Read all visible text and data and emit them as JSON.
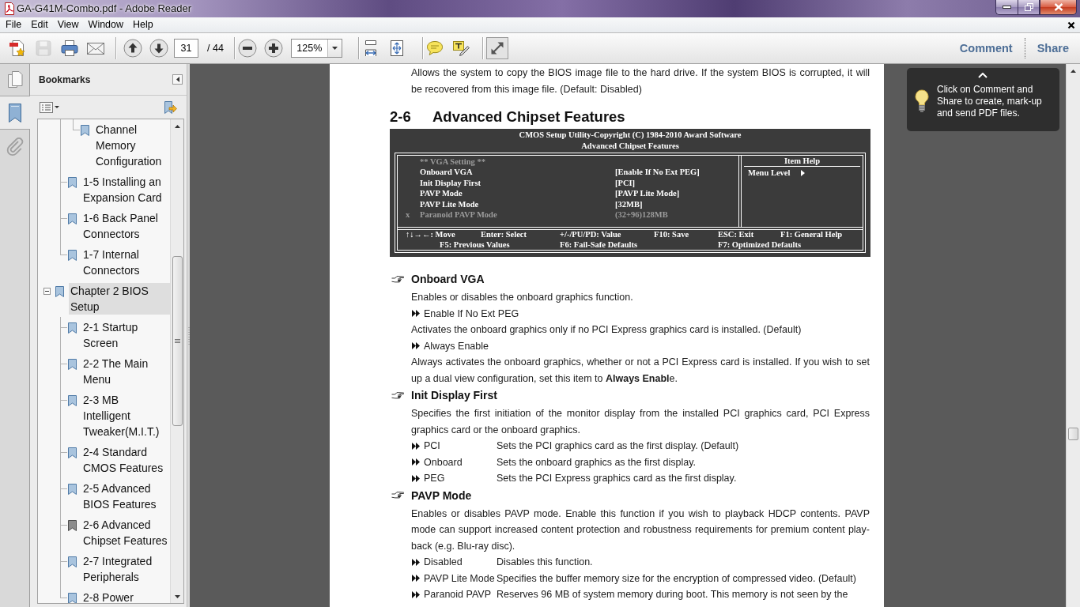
{
  "window": {
    "title": "GA-G41M-Combo.pdf - Adobe Reader"
  },
  "menu": [
    {
      "label": "File"
    },
    {
      "label": "Edit"
    },
    {
      "label": "View"
    },
    {
      "label": "Window"
    },
    {
      "label": "Help"
    }
  ],
  "toolbar": {
    "groups": [
      [
        {
          "kind": "create",
          "disabled": false
        },
        {
          "kind": "save",
          "disabled": true
        },
        {
          "kind": "print",
          "disabled": false
        },
        {
          "kind": "email",
          "disabled": false
        }
      ],
      [
        {
          "kind": "previous",
          "disabled": false
        },
        {
          "kind": "next",
          "disabled": false
        },
        {
          "kind": "page",
          "value": "31",
          "total": "/ 44",
          "disabled": false
        }
      ],
      [
        {
          "kind": "zoom-out",
          "disabled": false
        },
        {
          "kind": "zoom-in",
          "disabled": false
        },
        {
          "kind": "zoom",
          "value": "125%",
          "disabled": false
        }
      ],
      [
        {
          "kind": "fit-width",
          "disabled": false
        },
        {
          "kind": "fit-page",
          "disabled": false
        }
      ],
      [
        {
          "kind": "comment",
          "disabled": false
        },
        {
          "kind": "annotate",
          "disabled": false
        }
      ],
      [
        {
          "kind": "full-screen",
          "disabled": false
        }
      ]
    ],
    "panes": [
      {
        "label": "Comment"
      },
      {
        "label": "Share"
      }
    ]
  },
  "nav_strip": [
    {
      "kind": "pages",
      "selected": false
    },
    {
      "kind": "bookmarks",
      "selected": true
    },
    {
      "kind": "attachments",
      "selected": false
    }
  ],
  "bookmarks": {
    "title": "Bookmarks",
    "tree": [
      {
        "children": [
          {
            "children": [
              {
                "label": "Channel Memory Configuration",
                "selected": false,
                "current": false
              }
            ]
          },
          {
            "label": "1-5 Installing an Expansion Card",
            "selected": false,
            "current": false
          },
          {
            "label": "1-6 Back Panel Connectors",
            "selected": false,
            "current": false
          },
          {
            "label": "1-7 Internal Connectors",
            "selected": false,
            "current": false
          }
        ]
      },
      {
        "label": "Chapter 2 BIOS Setup",
        "expanded": true,
        "selected": true,
        "current": false,
        "children": [
          {
            "label": "2-1 Startup Screen",
            "selected": false,
            "current": false
          },
          {
            "label": "2-2 The Main Menu",
            "selected": false,
            "current": false
          },
          {
            "label": "2-3 MB Intelligent Tweaker(M.I.T.)",
            "selected": false,
            "current": false
          },
          {
            "label": "2-4 Standard CMOS Features",
            "selected": false,
            "current": false
          },
          {
            "label": "2-5 Advanced BIOS Features",
            "selected": false,
            "current": false
          },
          {
            "label": "2-6 Advanced Chipset Features",
            "selected": false,
            "current": true
          },
          {
            "label": "2-7 Integrated Peripherals",
            "selected": false,
            "current": false
          },
          {
            "label": "2-8 Power",
            "selected": false,
            "current": false
          }
        ]
      }
    ]
  },
  "document": {
    "intro": {
      "lines": [
        "Allows the system to copy the BIOS image file to the hard drive. If the system BIOS is corrupted, it will",
        "be recovered from this image file. (Default: Disabled)"
      ]
    },
    "heading": {
      "number": "2-6",
      "title": "Advanced Chipset Features"
    },
    "bios_screen": {
      "title_lines": [
        "CMOS Setup Utility-Copyright (C) 1984-2010 Award Software",
        "Advanced Chipset Features"
      ],
      "rows": [
        {
          "kind": "header",
          "label": "** VGA Setting **",
          "disabled": true
        },
        {
          "kind": "setting",
          "label": "Onboard VGA",
          "value": "[Enable If No Ext PEG]",
          "disabled": false
        },
        {
          "kind": "setting",
          "label": "Init Display First",
          "value": "[PCI]",
          "disabled": false
        },
        {
          "kind": "setting",
          "label": "PAVP Mode",
          "value": "[PAVP Lite Mode]",
          "disabled": false
        },
        {
          "kind": "setting",
          "label": "PAVP Lite Mode",
          "value": "[32MB]",
          "disabled": false
        },
        {
          "kind": "setting",
          "label": "Paranoid PAVP Mode",
          "value": "(32+96)128MB",
          "disabled": true,
          "marker": "x"
        }
      ],
      "help": {
        "title": "Item Help",
        "menu_level": "Menu Level"
      },
      "legend": [
        [
          "↑↓→←: Move",
          "Enter: Select",
          "+/-/PU/PD: Value",
          "F10: Save",
          "ESC: Exit",
          "F1: General Help"
        ],
        [
          "F5: Previous Values",
          "F6: Fail-Safe Defaults",
          "F7: Optimized Defaults"
        ]
      ]
    },
    "sections": [
      {
        "title": "Onboard VGA",
        "blocks": [
          {
            "kind": "paragraph",
            "lines": [
              "Enables or disables the onboard graphics function."
            ]
          },
          {
            "kind": "option",
            "name": "Enable If No Ext PEG"
          },
          {
            "kind": "paragraph",
            "lines": [
              "Activates the onboard graphics only if no PCI Express graphics card is installed. (Default)"
            ]
          },
          {
            "kind": "option",
            "name": "Always Enable"
          },
          {
            "kind": "paragraph",
            "lines": [
              "Always activates the onboard graphics, whether or not a PCI Express card is installed. If you wish to set",
              "up a dual view configuration, set this item to **Always Enabl**e."
            ]
          }
        ]
      },
      {
        "title": "Init Display First",
        "blocks": [
          {
            "kind": "paragraph",
            "lines": [
              "Specifies the first initiation of the monitor display from the installed PCI graphics card, PCI Express",
              "graphics card or the onboard graphics."
            ]
          },
          {
            "kind": "option",
            "name": "PCI",
            "description": "Sets the PCI graphics card as the first display. (Default)"
          },
          {
            "kind": "option",
            "name": "Onboard",
            "description": "Sets the onboard graphics as the first display."
          },
          {
            "kind": "option",
            "name": "PEG",
            "description": "Sets the PCI Express graphics card as the first display."
          }
        ]
      },
      {
        "title": "PAVP Mode",
        "blocks": [
          {
            "kind": "paragraph",
            "lines": [
              "Enables or disables PAVP mode. Enable this function if you wish to playback HDCP contents. PAVP",
              "mode can support increased content protection and robustness requirements for premium content play-",
              "back (e.g. Blu-ray disc)."
            ]
          },
          {
            "kind": "option",
            "name": "Disabled",
            "description": "Disables this function."
          },
          {
            "kind": "option",
            "name": "PAVP Lite Mode",
            "description": "Specifies the buffer memory size for the encryption of compressed video. (Default)"
          },
          {
            "kind": "option",
            "name": "Paranoid PAVP",
            "description": "Reserves 96 MB of system memory during boot. This memory is not seen by the"
          }
        ]
      }
    ]
  },
  "tip": {
    "lines": [
      "Click on Comment and",
      "Share to create, mark-up",
      "and send PDF files."
    ]
  }
}
